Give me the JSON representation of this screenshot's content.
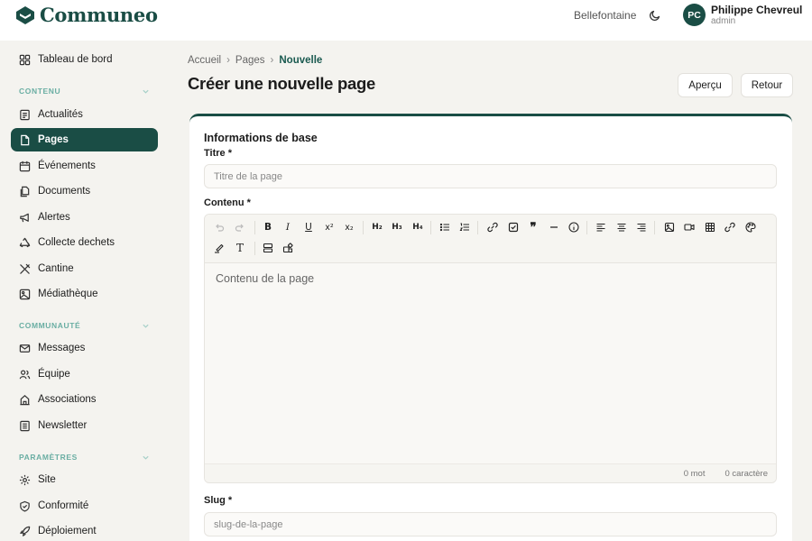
{
  "app": {
    "name": "Communeo",
    "town": "Bellefontaine"
  },
  "user": {
    "initials": "PC",
    "name": "Philippe Chevreul",
    "role": "admin"
  },
  "sidebar": {
    "top_item": {
      "label": "Tableau de bord",
      "icon": "dashboard-icon"
    },
    "sections": [
      {
        "title": "CONTENU",
        "items": [
          {
            "label": "Actualités",
            "icon": "newspaper-icon"
          },
          {
            "label": "Pages",
            "icon": "page-icon",
            "active": true
          },
          {
            "label": "Événements",
            "icon": "calendar-icon"
          },
          {
            "label": "Documents",
            "icon": "documents-icon"
          },
          {
            "label": "Alertes",
            "icon": "megaphone-icon"
          },
          {
            "label": "Collecte dechets",
            "icon": "recycle-icon"
          },
          {
            "label": "Cantine",
            "icon": "utensils-icon"
          },
          {
            "label": "Médiathèque",
            "icon": "image-icon"
          }
        ]
      },
      {
        "title": "COMMUNAUTÉ",
        "items": [
          {
            "label": "Messages",
            "icon": "mail-icon"
          },
          {
            "label": "Équipe",
            "icon": "users-icon"
          },
          {
            "label": "Associations",
            "icon": "building-icon"
          },
          {
            "label": "Newsletter",
            "icon": "newsletter-icon"
          }
        ]
      },
      {
        "title": "PARAMÈTRES",
        "items": [
          {
            "label": "Site",
            "icon": "gear-icon"
          },
          {
            "label": "Conformité",
            "icon": "shield-check-icon"
          },
          {
            "label": "Déploiement",
            "icon": "rocket-icon"
          }
        ]
      }
    ]
  },
  "breadcrumb": {
    "home": "Accueil",
    "section": "Pages",
    "current": "Nouvelle"
  },
  "page": {
    "title": "Créer une nouvelle page"
  },
  "actions": {
    "preview": "Aperçu",
    "back": "Retour"
  },
  "form": {
    "section_title": "Informations de base",
    "title_label": "Titre *",
    "title_placeholder": "Titre de la page",
    "content_label": "Contenu *",
    "content_placeholder": "Contenu de la page",
    "slug_label": "Slug *",
    "slug_placeholder": "slug-de-la-page"
  },
  "toolbar": {
    "bold": "B",
    "italic": "I",
    "underline": "U",
    "superscript": "x²",
    "subscript": "x₂",
    "h2": "H₂",
    "h3": "H₃",
    "h4": "H₄",
    "text": "T"
  },
  "counter": {
    "words": "0 mot",
    "characters": "0 caractère"
  },
  "colors": {
    "brand": "#1a4d45",
    "section_title": "#6aaea3",
    "background": "#f4f3ef"
  }
}
